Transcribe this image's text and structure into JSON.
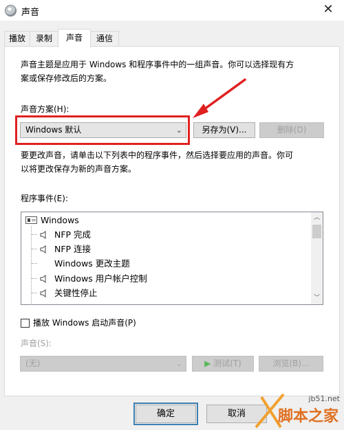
{
  "window": {
    "title": "声音",
    "close_glyph": "✕"
  },
  "tabs": [
    {
      "label": "播放",
      "active": false
    },
    {
      "label": "录制",
      "active": false
    },
    {
      "label": "声音",
      "active": true
    },
    {
      "label": "通信",
      "active": false
    }
  ],
  "description": {
    "line1": "声音主题是应用于 Windows 和程序事件中的一组声音。你可以选择现有方",
    "line2": "案或保存修改后的方案。"
  },
  "scheme": {
    "label": "声音方案(H):",
    "value": "Windows 默认",
    "save_as_label": "另存为(V)...",
    "delete_label": "删除(D)"
  },
  "instructions": {
    "line1": "要更改声音，请单击以下列表中的程序事件，然后选择要应用的声音。你可",
    "line2": "以将更改保存为新的声音方案。"
  },
  "events": {
    "label": "程序事件(E):",
    "items": [
      {
        "label": "Windows",
        "icon": "folder-icon",
        "level": 0
      },
      {
        "label": "NFP 完成",
        "icon": "speaker-icon",
        "level": 1
      },
      {
        "label": "NFP 连接",
        "icon": "speaker-icon",
        "level": 1
      },
      {
        "label": "Windows 更改主题",
        "icon": "none",
        "level": 1
      },
      {
        "label": "Windows 用户帐户控制",
        "icon": "speaker-icon",
        "level": 1
      },
      {
        "label": "关键性停止",
        "icon": "speaker-icon",
        "level": 1
      }
    ]
  },
  "startup_sound": {
    "label": "播放 Windows 启动声音(P)",
    "checked": false
  },
  "sound": {
    "label": "声音(S):",
    "value": "(无)",
    "test_label": "测试(T)",
    "browse_label": "浏览(B)..."
  },
  "footer": {
    "ok_label": "确定",
    "cancel_label": "取消"
  },
  "watermark": {
    "url": "jb51.net",
    "name": "脚本之家"
  },
  "colors": {
    "annotation_red": "#e02020",
    "watermark_orange": "#e07020"
  }
}
